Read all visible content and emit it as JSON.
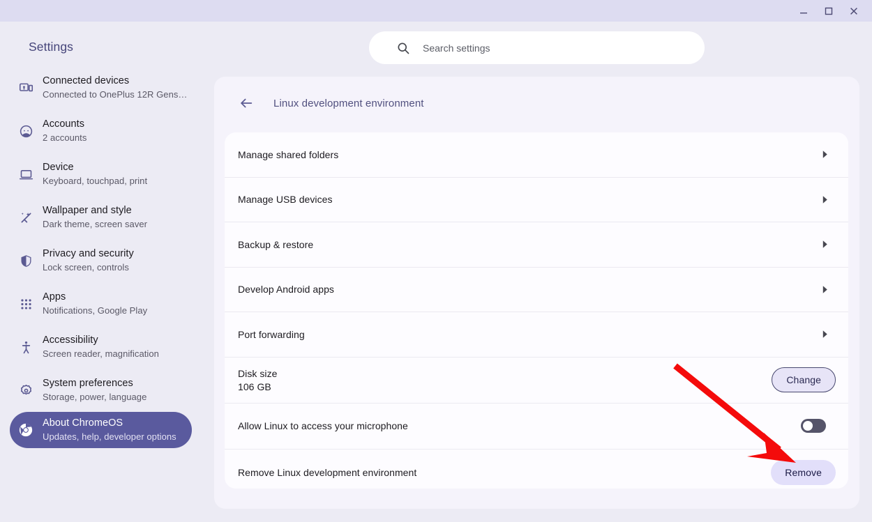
{
  "window": {
    "minimize_label": "Minimize",
    "maximize_label": "Maximize",
    "close_label": "Close"
  },
  "sidebar": {
    "brand": "Settings",
    "items": [
      {
        "label": "Connected devices",
        "sublabel": "Connected to OnePlus 12R Gens…",
        "icon": "devices-icon",
        "selected": false
      },
      {
        "label": "Accounts",
        "sublabel": "2 accounts",
        "icon": "account-icon",
        "selected": false
      },
      {
        "label": "Device",
        "sublabel": "Keyboard, touchpad, print",
        "icon": "laptop-icon",
        "selected": false
      },
      {
        "label": "Wallpaper and style",
        "sublabel": "Dark theme, screen saver",
        "icon": "wand-icon",
        "selected": false
      },
      {
        "label": "Privacy and security",
        "sublabel": "Lock screen, controls",
        "icon": "shield-icon",
        "selected": false
      },
      {
        "label": "Apps",
        "sublabel": "Notifications, Google Play",
        "icon": "apps-grid-icon",
        "selected": false
      },
      {
        "label": "Accessibility",
        "sublabel": "Screen reader, magnification",
        "icon": "accessibility-icon",
        "selected": false
      },
      {
        "label": "System preferences",
        "sublabel": "Storage, power, language",
        "icon": "gear-icon",
        "selected": false
      },
      {
        "label": "About ChromeOS",
        "sublabel": "Updates, help, developer options",
        "icon": "chrome-icon",
        "selected": true
      }
    ]
  },
  "search": {
    "placeholder": "Search settings",
    "value": "",
    "icon": "search-icon"
  },
  "page": {
    "back_label": "Back",
    "title": "Linux development environment",
    "rows": [
      {
        "label": "Manage shared folders",
        "control": "chevron"
      },
      {
        "label": "Manage USB devices",
        "control": "chevron"
      },
      {
        "label": "Backup & restore",
        "control": "chevron"
      },
      {
        "label": "Develop Android apps",
        "control": "chevron"
      },
      {
        "label": "Port forwarding",
        "control": "chevron"
      },
      {
        "label": "Disk size",
        "sublabel": "106 GB",
        "control": "button-outline",
        "button_label": "Change"
      },
      {
        "label": "Allow Linux to access your microphone",
        "control": "toggle",
        "toggle_on": false
      },
      {
        "label": "Remove Linux development environment",
        "control": "button-filled",
        "button_label": "Remove"
      }
    ]
  },
  "annotation": {
    "arrow_color": "#f40b0b",
    "points_to": "Remove"
  },
  "colors": {
    "titlebar": "#dddcf1",
    "app_bg": "#ecebf4",
    "panel_bg": "#f5f3fb",
    "card_bg": "#fdfcff",
    "accent": "#5a5a9e",
    "selected_pill": "#5a5a9e",
    "button_filled": "#e2dffa",
    "button_outline_bg": "#e7e4f7",
    "toggle_off": "#555469"
  }
}
